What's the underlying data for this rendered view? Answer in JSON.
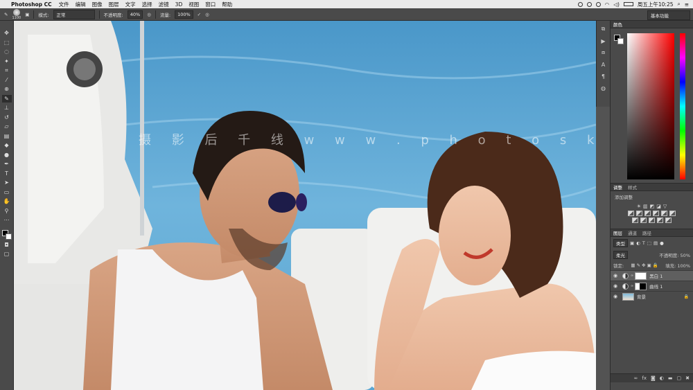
{
  "menubar": {
    "app_name": "Photoshop CC",
    "items": [
      "文件",
      "编辑",
      "图像",
      "图层",
      "文字",
      "选择",
      "滤镜",
      "3D",
      "视图",
      "窗口",
      "帮助"
    ],
    "clock": "周五上午10:25"
  },
  "options_bar": {
    "brush_size": "1100",
    "mode_label": "模式:",
    "mode_value": "正常",
    "opacity_label": "不透明度:",
    "opacity_value": "40%",
    "flow_label": "流量:",
    "flow_value": "100%",
    "workspace": "基本功能"
  },
  "canvas": {
    "watermark": "摄 影 后 千 线   w w w . p h o t o s k s . v"
  },
  "panels": {
    "color_tab": "颜色",
    "adjust_tabs": [
      "调整",
      "样式"
    ],
    "adjust_label": "添加调整",
    "layer_tabs": [
      "图层",
      "通道",
      "路径"
    ],
    "kind_filter": "类型",
    "blend_mode": "柔光",
    "opacity_label": "不透明度:",
    "opacity_value": "50%",
    "lock_label": "锁定:",
    "fill_label": "填充:",
    "fill_value": "100%"
  },
  "layers": [
    {
      "name": "黑白 1",
      "type": "adjustment",
      "selected": true
    },
    {
      "name": "曲线 1",
      "type": "curves",
      "selected": false
    },
    {
      "name": "背景",
      "type": "background",
      "selected": false
    }
  ]
}
